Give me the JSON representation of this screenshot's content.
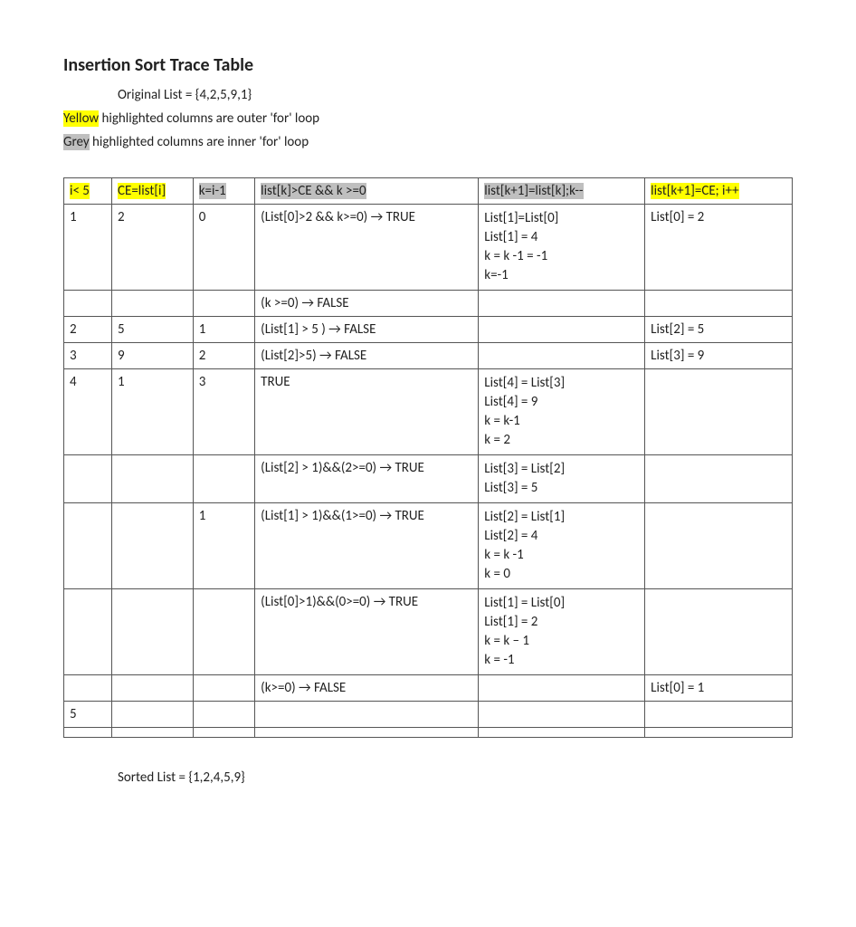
{
  "title": "Insertion Sort Trace Table",
  "original_list_label": "Original List = {4,2,5,9,1}",
  "legend_yellow_word": "Yellow",
  "legend_yellow_rest": " highlighted columns are outer 'for' loop",
  "legend_grey_word": "Grey",
  "legend_grey_rest": " highlighted columns are inner 'for' loop",
  "headers": {
    "c0": "i< 5",
    "c1": "CE=list[i]",
    "c2": "k=i-1",
    "c3": "list[k]>CE && k >=0",
    "c4": "list[k+1]=list[k];k--",
    "c5": "list[k+1]=CE; i++"
  },
  "rows": [
    {
      "i": "1",
      "ce": "2",
      "k": "0",
      "cond": "(List[0]>2 && k>=0) → TRUE",
      "act_lines": [
        "List[1]=List[0]",
        "List[1] = 4",
        "k = k -1 = -1",
        "k=-1"
      ],
      "out": "List[0] = 2"
    },
    {
      "i": "",
      "ce": "",
      "k": "",
      "cond": "(k >=0) → FALSE",
      "act_lines": [],
      "out": ""
    },
    {
      "i": "2",
      "ce": "5",
      "k": "1",
      "cond": "(List[1] > 5 ) → FALSE",
      "act_lines": [],
      "out": "List[2] = 5"
    },
    {
      "i": "3",
      "ce": "9",
      "k": "2",
      "cond": "(List[2]>5) → FALSE",
      "act_lines": [],
      "out": "List[3] = 9"
    },
    {
      "i": "4",
      "ce": "1",
      "k": "3",
      "cond": "TRUE",
      "act_lines": [
        "List[4] = List[3]",
        "List[4] = 9",
        "k = k-1",
        "k = 2"
      ],
      "out": ""
    },
    {
      "i": "",
      "ce": "",
      "k": "",
      "cond": "(List[2] > 1)&&(2>=0) → TRUE",
      "act_lines": [
        "List[3] = List[2]",
        "List[3] = 5"
      ],
      "out": ""
    },
    {
      "i": "",
      "ce": "",
      "k": "1",
      "cond": "(List[1] > 1)&&(1>=0) → TRUE",
      "act_lines": [
        "List[2] = List[1]",
        "List[2] = 4",
        "k = k -1",
        "k = 0"
      ],
      "out": ""
    },
    {
      "i": "",
      "ce": "",
      "k": "",
      "cond": "(List[0]>1)&&(0>=0) → TRUE",
      "act_lines": [
        "List[1] = List[0]",
        "List[1] = 2",
        "k = k – 1",
        "k = -1"
      ],
      "out": ""
    },
    {
      "i": "",
      "ce": "",
      "k": "",
      "cond": "(k>=0) → FALSE",
      "act_lines": [],
      "out": "List[0] = 1"
    },
    {
      "i": "5",
      "ce": "",
      "k": "",
      "cond": "",
      "act_lines": [],
      "out": ""
    },
    {
      "i": "",
      "ce": "",
      "k": "",
      "cond": "",
      "act_lines": [],
      "out": ""
    }
  ],
  "sorted_list_label": "Sorted List = {1,2,4,5,9}"
}
